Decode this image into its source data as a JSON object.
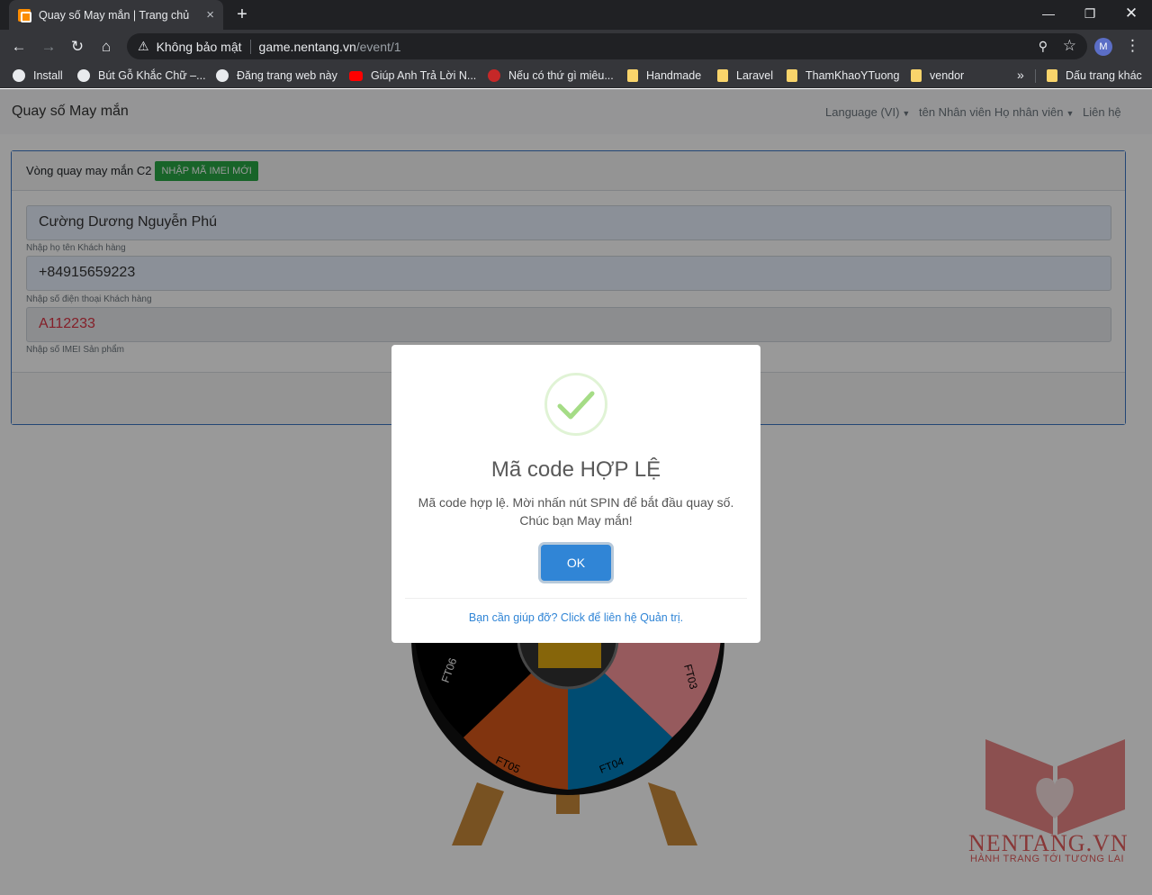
{
  "browser": {
    "tab_title": "Quay số May mắn | Trang chủ",
    "tab_close": "×",
    "new_tab": "+",
    "not_secure": "Không bảo mật",
    "url_host": "game.nentang.vn",
    "url_path": "/event/1",
    "profile_initial": "M",
    "bookmarks": [
      {
        "label": "Install",
        "icon": "globe-icon"
      },
      {
        "label": "Bút Gỗ Khắc Chữ –...",
        "icon": "globe-icon"
      },
      {
        "label": "Đăng trang web này",
        "icon": "globe-icon"
      },
      {
        "label": "Giúp Anh Trả Lời N...",
        "icon": "youtube-icon"
      },
      {
        "label": "Nếu có thứ gì miêu...",
        "icon": "calendar-icon"
      },
      {
        "label": "Handmade",
        "icon": "folder-icon"
      },
      {
        "label": "Laravel",
        "icon": "folder-icon"
      },
      {
        "label": "ThamKhaoYTuong",
        "icon": "folder-icon"
      },
      {
        "label": "vendor",
        "icon": "folder-icon"
      },
      {
        "label": "Dấu trang khác",
        "icon": "folder-icon"
      }
    ],
    "bookmarks_more": "»"
  },
  "navbar": {
    "brand": "Quay số May mắn",
    "language": "Language (VI)",
    "staff": "tên Nhân viên Họ nhân viên",
    "contact": "Liên hệ"
  },
  "form": {
    "title": "Vòng quay may mắn C2",
    "new_imei_button": "NHẬP MÃ IMEI MỚI",
    "name_value": "Cường Dương Nguyễn Phú",
    "name_help": "Nhập họ tên Khách hàng",
    "phone_value": "+84915659223",
    "phone_help": "Nhập số điện thoại Khách hàng",
    "imei_value": "A112233",
    "imei_help": "Nhập số IMEI Sản phẩm"
  },
  "wheel": {
    "segments": [
      "FT06",
      "FT05",
      "FT04",
      "FT03"
    ],
    "colors": [
      "#000000",
      "#d8571a",
      "#007fbe",
      "#fa969c"
    ]
  },
  "watermark": {
    "brand": "NENTANG.VN",
    "slogan": "HÀNH TRANG TỚI TƯƠNG LAI"
  },
  "modal": {
    "title": "Mã code HỢP LỆ",
    "message": "Mã code hợp lệ. Mời nhấn nút SPIN để bắt đầu quay số. Chúc bạn May mắn!",
    "ok_label": "OK",
    "footer_link": "Bạn cần giúp đỡ? Click để liên hệ Quản trị.",
    "success_color": "#a5dc86",
    "button_color": "#3085d6"
  }
}
